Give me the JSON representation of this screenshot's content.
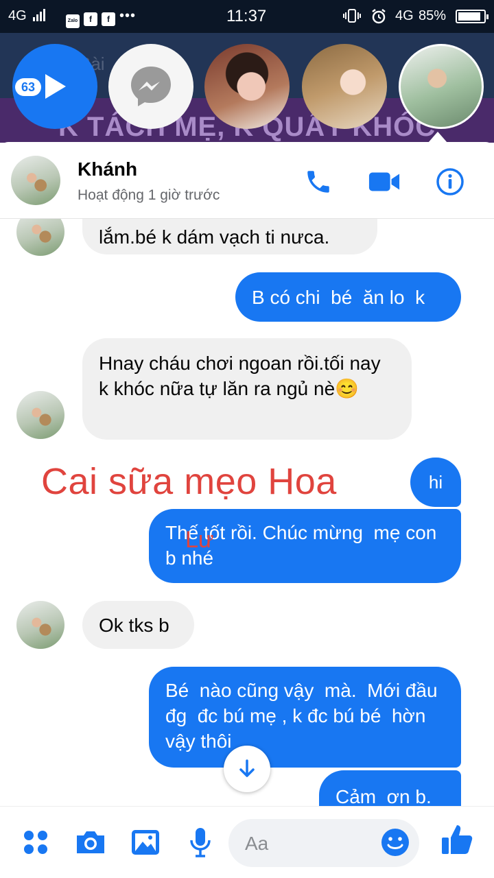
{
  "status_bar": {
    "network_left": "4G",
    "zalo_label": "Zalo",
    "fb_label": "f",
    "more": "•••",
    "time": "11:37",
    "network_right": "4G",
    "battery": "85%"
  },
  "chat_heads": {
    "unread_count": "63",
    "background_text_small": "Bài",
    "background_banner": "K TÁCH MẸ, K QUẤY KHÓC"
  },
  "header": {
    "contact_name": "Khánh",
    "activity_status": "Hoạt động 1 giờ trước",
    "icons": [
      "phone-icon",
      "video-camera-icon",
      "info-icon"
    ]
  },
  "messages": [
    {
      "direction": "in",
      "text": "lắm.bé k dám vạch ti nưca."
    },
    {
      "direction": "out",
      "text": "B có chi  bé  ăn lo  k"
    },
    {
      "direction": "in",
      "text": "Hnay cháu chơi ngoan rồi.tối nay k khóc nữa tự lăn ra ngủ nè😊"
    },
    {
      "direction": "out",
      "text": "hi"
    },
    {
      "direction": "out",
      "text": "Thế tốt rồi. Chúc mừng  mẹ con b nhé"
    },
    {
      "direction": "in",
      "text": "Ok tks b"
    },
    {
      "direction": "out",
      "text": "Bé  nào cũng vậy  mà.  Mới đầu  đg  đc bú mẹ , k đc bú bé  hờn  vậy thôi"
    },
    {
      "direction": "out",
      "text": "Cảm  ơn b."
    }
  ],
  "watermark": {
    "line1": "Cai sữa mẹo Hoa",
    "line2": "Lư"
  },
  "composer": {
    "placeholder": "Aa",
    "icons": [
      "apps-icon",
      "camera-icon",
      "image-icon",
      "microphone-icon",
      "emoji-icon",
      "thumbs-up-icon"
    ]
  },
  "colors": {
    "accent": "#1877f2",
    "incoming_bubble": "#f0f0f0",
    "watermark": "#e0443e"
  }
}
